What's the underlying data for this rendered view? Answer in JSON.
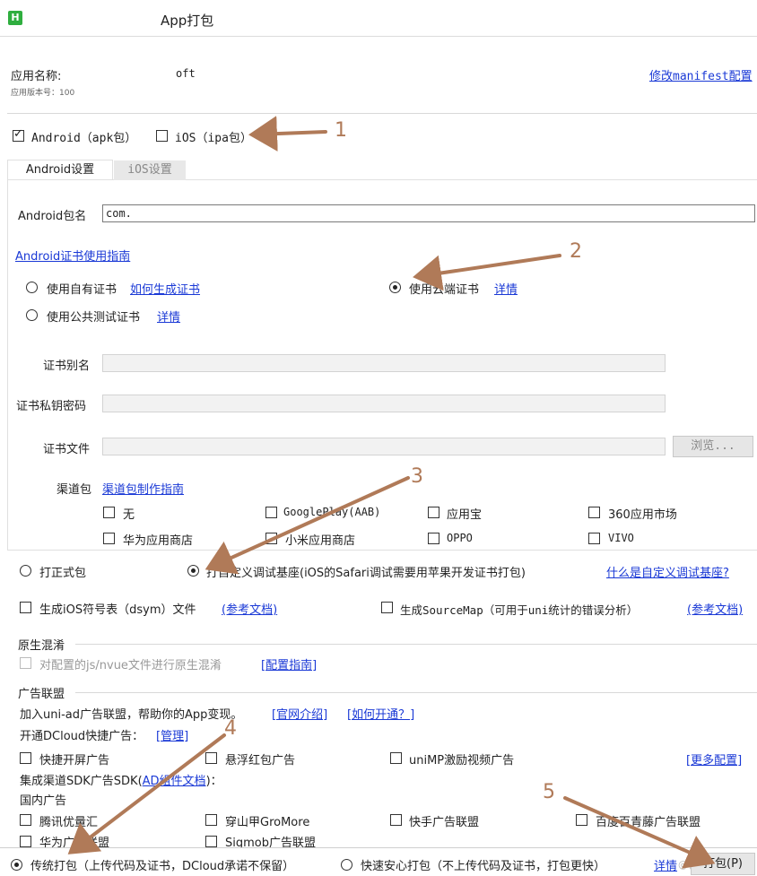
{
  "window": {
    "title": "App打包",
    "logo_letter": "H"
  },
  "app": {
    "name_label": "应用名称:",
    "name_value": "oft",
    "version_label": "应用版本号：100",
    "manifest_link": "修改manifest配置"
  },
  "platforms": {
    "android_label": "Android（apk包）",
    "android_checked": true,
    "ios_label": "iOS（ipa包）",
    "ios_checked": false
  },
  "tabs": [
    {
      "label": "Android设置",
      "active": true
    },
    {
      "label": "iOS设置",
      "active": false
    }
  ],
  "android": {
    "package_label": "Android包名",
    "package_value": "com.",
    "cert_guide_link": "Android证书使用指南",
    "cert_options": {
      "own_label": "使用自有证书",
      "own_link": "如何生成证书",
      "cloud_label": "使用云端证书",
      "cloud_link": "详情",
      "public_label": "使用公共测试证书",
      "public_link": "详情",
      "selected": "cloud"
    },
    "alias_label": "证书别名",
    "password_label": "证书私钥密码",
    "file_label": "证书文件",
    "browse_button": "浏览...",
    "channel_label": "渠道包",
    "channel_guide_link": "渠道包制作指南",
    "channels": [
      {
        "label": "无",
        "checked": false
      },
      {
        "label": "GooglePlay(AAB)",
        "checked": false
      },
      {
        "label": "应用宝",
        "checked": false
      },
      {
        "label": "360应用市场",
        "checked": false
      },
      {
        "label": "华为应用商店",
        "checked": false
      },
      {
        "label": "小米应用商店",
        "checked": false
      },
      {
        "label": "OPPO",
        "checked": false
      },
      {
        "label": "VIVO",
        "checked": false
      }
    ]
  },
  "build_type": {
    "formal_label": "打正式包",
    "custom_label": "打自定义调试基座(iOS的Safari调试需要用苹果开发证书打包)",
    "custom_link": "什么是自定义调试基座?",
    "selected": "custom"
  },
  "options": {
    "dsym_label": "生成iOS符号表（dsym）文件",
    "dsym_link": "(参考文档)",
    "sourcemap_label": "生成SourceMap（可用于uni统计的错误分析）",
    "sourcemap_link": "(参考文档)"
  },
  "obfuscation": {
    "section_title": "原生混淆",
    "checkbox_label": "对配置的js/nvue文件进行原生混淆",
    "link": "[配置指南]"
  },
  "ads": {
    "section_title": "广告联盟",
    "join_text": "加入uni-ad广告联盟，帮助你的App变现。",
    "official_link": "[官网介绍]",
    "howto_link": "[如何开通？]",
    "dcloud_label": "开通DCloud快捷广告：",
    "manage_link": "[管理]",
    "quick_ads": [
      {
        "label": "快捷开屏广告"
      },
      {
        "label": "悬浮红包广告"
      },
      {
        "label": "uniMP激励视频广告"
      }
    ],
    "more_link": "[更多配置]",
    "sdk_label_prefix": "集成渠道SDK广告SDK(",
    "sdk_link": "AD组件文档",
    "sdk_label_suffix": ")：",
    "domestic_label": "国内广告",
    "domestic_ads": [
      {
        "label": "腾讯优量汇"
      },
      {
        "label": "穿山甲GroMore"
      },
      {
        "label": "快手广告联盟"
      },
      {
        "label": "百度百青藤广告联盟"
      }
    ],
    "partial_row": [
      {
        "label": "华为广告联盟"
      },
      {
        "label": "Sigmob广告联盟"
      }
    ]
  },
  "footer": {
    "traditional_label": "传统打包（上传代码及证书，DCloud承诺不保留）",
    "fast_label": "快速安心打包（不上传代码及证书，打包更快）",
    "details_link": "详情",
    "pack_button": "打包(P)",
    "watermark": "@稀土掘金",
    "selected": "traditional"
  },
  "annotations": {
    "arrow_color": "#b07a58",
    "labels": [
      "1",
      "2",
      "3",
      "4",
      "5"
    ]
  }
}
